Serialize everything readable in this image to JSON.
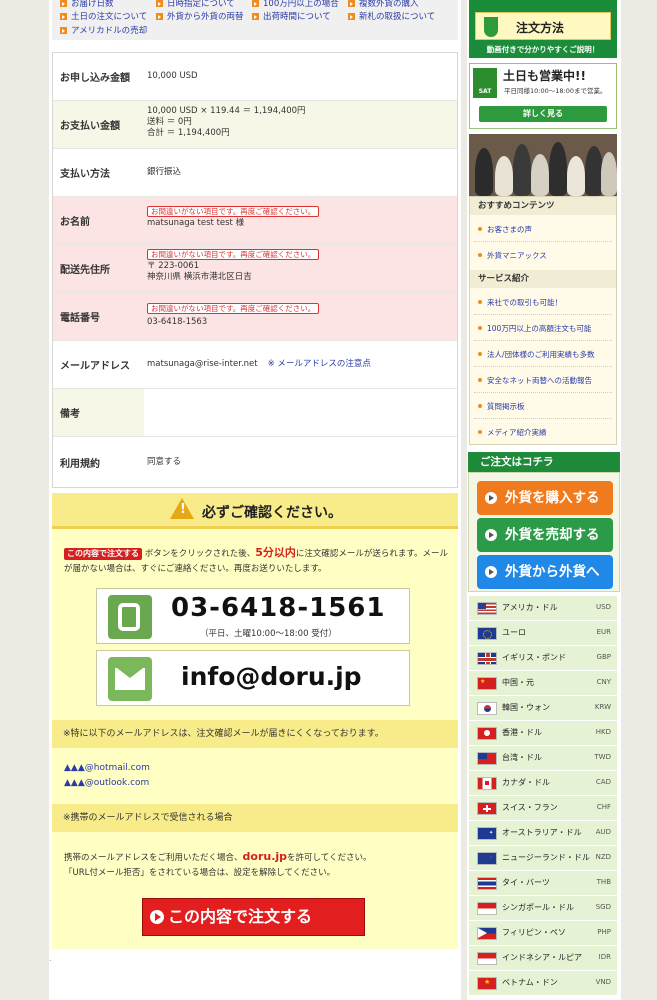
{
  "top_links": [
    {
      "label": "お届け日数"
    },
    {
      "label": "日時指定について"
    },
    {
      "label": "100万円以上の場合"
    },
    {
      "label": "複数外貨の購入"
    },
    {
      "label": "土日の注文について"
    },
    {
      "label": "外貨から外貨の両替"
    },
    {
      "label": "出荷時間について"
    },
    {
      "label": "新札の取扱について"
    },
    {
      "label": "アメリカドルの売却"
    }
  ],
  "form": {
    "amount": {
      "label": "お申し込み金額",
      "value": "10,000 USD"
    },
    "payment_amount": {
      "label": "お支払い金額",
      "line1": "10,000 USD × 119.44 ＝ 1,194,400円",
      "line2": "送料 ＝ 0円",
      "line3": "合計 ＝ 1,194,400円"
    },
    "payment_method": {
      "label": "支払い方法",
      "value": "銀行振込"
    },
    "name": {
      "label": "お名前",
      "error": "お間違いがない項目です。再度ご確認ください。",
      "value": "matsunaga test test 様"
    },
    "address": {
      "label": "配送先住所",
      "error": "お間違いがない項目です。再度ご確認ください。",
      "line1": "〒 223-0061",
      "line2": "神奈川県 横浜市港北区日吉"
    },
    "phone": {
      "label": "電話番号",
      "error": "お間違いがない項目です。再度ご確認ください。",
      "value": "03-6418-1563"
    },
    "email": {
      "label": "メールアドレス",
      "value": "matsunaga@rise-inter.net",
      "note": "※ メールアドレスの注意点"
    },
    "remarks": {
      "label": "備考",
      "value": ""
    },
    "terms": {
      "label": "利用規約",
      "value": "同意する"
    }
  },
  "confirm": {
    "title": "必ずご確認ください。",
    "inline_button": "この内容で注文する",
    "text_a": "ボタンをクリックされた後、",
    "text_red": "5分以内",
    "text_b": "に注文確認メールが送られます。メールが届かない場合は、すぐにご連絡ください。再度お送りいたします。",
    "tel": "03-6418-1561",
    "tel_hours": "（平日、土曜10:00～18:00 受付）",
    "mail": "info@doru.jp",
    "band1": "※特に以下のメールアドレスは、注文確認メールが届きにくくなっております。",
    "addr1_tri": "▲▲▲",
    "addr1_dom": "@hotmail.com",
    "addr2_tri": "▲▲▲",
    "addr2_dom": "@outlook.com",
    "band2": "※携帯のメールアドレスで受信される場合",
    "mobile_a": "携帯のメールアドレスをご利用いただく場合、",
    "mobile_dom": "doru.jp",
    "mobile_b": "を許可してください。",
    "mobile_c": "「URL付メール拒否」をされている場合は、設定を解除してください。",
    "order_button": "この内容で注文する"
  },
  "sidebar": {
    "guide_title": "注文方法",
    "guide_sub": "動画付きで分かりやすくご説明！",
    "sat_badge": "SAT",
    "sat_title": "土日も営業中!!",
    "sat_hours": "平日同様10:00～18:00まで営業。",
    "sat_button": "詳しく見る",
    "menu_head1": "おすすめコンテンツ",
    "menu1": [
      "お客さまの声",
      "外貨マニアックス"
    ],
    "menu_head2": "サービス紹介",
    "menu2": [
      "来社での取引も可能！",
      "100万円以上の高額注文も可能",
      "法人/団体様のご利用実績も多数",
      "安全なネット両替への活動報告",
      "質問掲示板",
      "メディア紹介実績"
    ],
    "order_head": "ご注文はコチラ",
    "order_buttons": [
      "外貨を購入する",
      "外貨を売却する",
      "外貨から外貨へ"
    ],
    "currencies": [
      {
        "name": "アメリカ・ドル",
        "code": "USD"
      },
      {
        "name": "ユーロ",
        "code": "EUR"
      },
      {
        "name": "イギリス・ポンド",
        "code": "GBP"
      },
      {
        "name": "中国・元",
        "code": "CNY"
      },
      {
        "name": "韓国・ウォン",
        "code": "KRW"
      },
      {
        "name": "香港・ドル",
        "code": "HKD"
      },
      {
        "name": "台湾・ドル",
        "code": "TWD"
      },
      {
        "name": "カナダ・ドル",
        "code": "CAD"
      },
      {
        "name": "スイス・フラン",
        "code": "CHF"
      },
      {
        "name": "オーストラリア・ドル",
        "code": "AUD"
      },
      {
        "name": "ニュージーランド・ドル",
        "code": "NZD"
      },
      {
        "name": "タイ・バーツ",
        "code": "THB"
      },
      {
        "name": "シンガポール・ドル",
        "code": "SGD"
      },
      {
        "name": "フィリピン・ペソ",
        "code": "PHP"
      },
      {
        "name": "インドネシア・ルピア",
        "code": "IDR"
      },
      {
        "name": "ベトナム・ドン",
        "code": "VND"
      }
    ]
  }
}
